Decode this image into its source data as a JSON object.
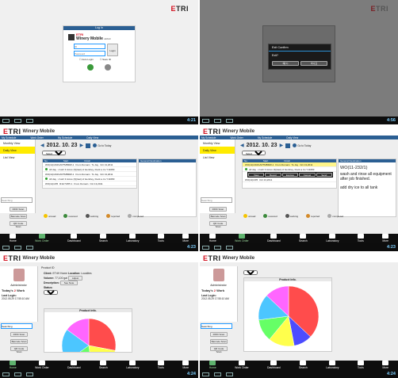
{
  "login": {
    "brand": "ETRI",
    "header": "Log In",
    "app_name": "Winery Mobile",
    "version": "v0.9.3",
    "id_placeholder": "ID",
    "password_placeholder": "Password",
    "login_button": "Login",
    "auto_login": "Auto Login",
    "save_id": "Save ID",
    "clock": "4:21"
  },
  "exit_dialog": {
    "title": "Exit Confirm",
    "message": "Exit?",
    "yes": "예(Y)",
    "no": "아니요",
    "clock": "4:56"
  },
  "daily": {
    "brand": "ETRI",
    "app_name": "Winery Mobile",
    "breadcrumb": [
      "My Schedule",
      "Work Order",
      "My Schedule",
      "Daily View"
    ],
    "left_tabs": [
      "Monthly View",
      "Daily View",
      "List View"
    ],
    "date": "2012. 10. 23",
    "goto_today": "Go to Today",
    "select_label": "Select",
    "col_headers": [
      "No",
      "Start",
      "Finish",
      "General Destination"
    ],
    "rows": [
      {
        "id": "WO(11)/232/1/R/TMBRW-1",
        "from": "From Domain",
        "to": "To Jay",
        "date": "Oct 13,2011",
        "note": "All day : crush 3 Acres (3)(last) of Hershey, block a tru Y11683"
      },
      {
        "id": "WO(11)/232/1/R/TMBRW-1",
        "from": "From Domain",
        "to": "To Jay",
        "date": "Oct 13,2011",
        "note": "All day : crush 3 Acres (3)(last) of Hershey, block a tru Y11683"
      },
      {
        "id": "WO(11)/235",
        "from": "R11/7/255 1",
        "to": "From Domain",
        "date": "Oct 13,2011",
        "note": "All day : crush 3 Acres (3)(last) of Hershey, block a tru Y11683"
      }
    ],
    "search_placeholder": "Searching",
    "side_buttons": [
      "RFID Scan",
      "Barcode Scan",
      "QR Code Scan"
    ],
    "legend": [
      "unread",
      "received",
      "working",
      "reported",
      "completed"
    ],
    "tabs": [
      "Home",
      "Work Order",
      "Dashboard",
      "Search",
      "Laboratory",
      "Tools",
      "More"
    ],
    "clock": "4:23"
  },
  "detail": {
    "popup_items": [
      "View",
      "Report",
      "Explore",
      "Cancel",
      "Send Message"
    ],
    "wo_title": "WO(11-232/1)",
    "wo_body": "wash and rinse all equipment after job finished.",
    "wo_note": "add dry ice to all tank",
    "clock": "4:23"
  },
  "product": {
    "brand": "ETRI",
    "app_name": "Winery Mobile",
    "section": "Product ID",
    "client_label": "Client:",
    "client_value": "ETriH Home",
    "location_label": "Location:",
    "location_value": "Localites",
    "volume_label": "Volume:",
    "volume_value": "77,100 gal",
    "adjust_button": "Adjust",
    "description_label": "Description:",
    "see_note": "See Note",
    "status_label": "Status:",
    "chart_select": "Chart",
    "profile_role": "Administrator",
    "today_label": "Today's",
    "today_count": "2",
    "today_suffix": "Work",
    "last_login_label": "Last Login:",
    "last_login_value": "2012.05.29 17:55:10 AM",
    "search_value": "Searching",
    "side_buttons": [
      "RFID Scan",
      "Barcode Scan",
      "QR Code Scan"
    ],
    "tabs": [
      "Home",
      "Work Order",
      "Dashboard",
      "Search",
      "Laboratory",
      "Tools",
      "More"
    ],
    "chart_title": "Product Info.",
    "clock": "4:24"
  },
  "chart_data": [
    {
      "type": "pie",
      "title": "Product Info.",
      "values": [
        28,
        20,
        17,
        20,
        15
      ],
      "colors": [
        "#ff4c4c",
        "#ffff4c",
        "#66ff66",
        "#4cc6ff",
        "#ff66ff"
      ]
    },
    {
      "type": "pie",
      "title": "Product Info.",
      "values": [
        37,
        10,
        14,
        12,
        14,
        13
      ],
      "colors": [
        "#ff4c4c",
        "#4c4cff",
        "#ffff4c",
        "#66ff66",
        "#4cc6ff",
        "#ff66ff"
      ]
    }
  ],
  "colors": {
    "brand_red": "#d31120",
    "breadcrumb": "#2b5f93",
    "highlight": "#ffeb00",
    "home_green": "#5fb36e"
  }
}
